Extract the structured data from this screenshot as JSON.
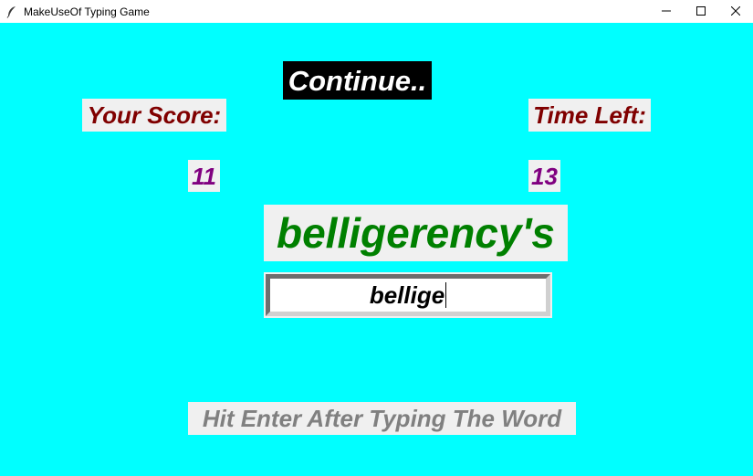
{
  "window": {
    "title": "MakeUseOf Typing Game",
    "icon": "feather-icon",
    "controls": [
      "minimize-icon",
      "maximize-icon",
      "close-icon"
    ]
  },
  "game": {
    "continue_label": "Continue..",
    "score_label": "Your Score:",
    "time_label": "Time Left:",
    "score_value": "11",
    "time_value": "13",
    "current_word": "belligerency's",
    "typed_text": "bellige",
    "hint": "Hit Enter After Typing The Word"
  },
  "colors": {
    "background": "#00ffff",
    "label_bg": "#f0f0f0",
    "continue_bg": "#000000",
    "continue_text": "#ffffff",
    "heading_text": "#800000",
    "value_text": "#800080",
    "word_text": "#008000",
    "hint_text": "#808080"
  }
}
